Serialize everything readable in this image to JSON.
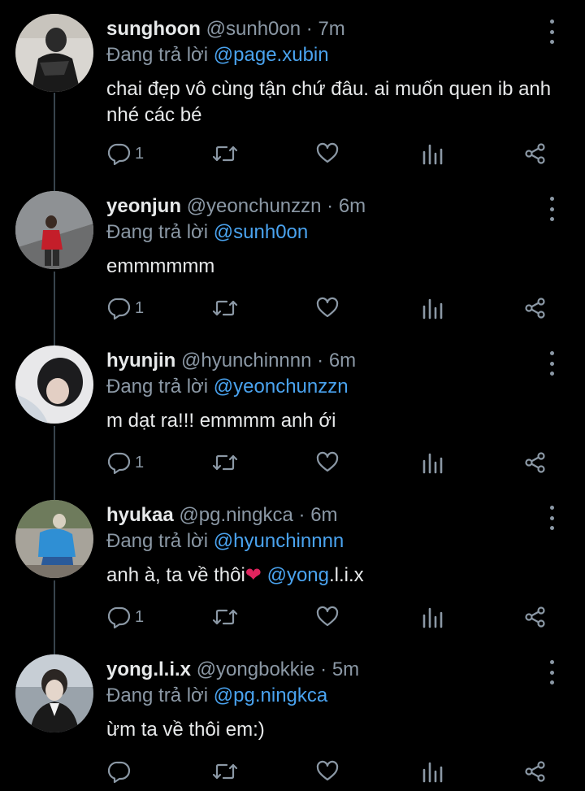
{
  "reply_prefix": "Đang trả lời",
  "tweets": [
    {
      "name": "sunghoon",
      "handle": "@sunh0on",
      "sep": "·",
      "time": "7m",
      "reply_to": "@page.xubin",
      "text": "chai đẹp vô cùng tận chứ đâu. ai muốn quen ib anh nhé các bé",
      "reply_count": "1"
    },
    {
      "name": "yeonjun",
      "handle": "@yeonchunzzn",
      "sep": "·",
      "time": "6m",
      "reply_to": "@sunh0on",
      "text": "emmmmmm",
      "reply_count": "1"
    },
    {
      "name": "hyunjin",
      "handle": "@hyunchinnnn",
      "sep": "·",
      "time": "6m",
      "reply_to": "@yeonchunzzn",
      "text": "m dạt ra!!! emmmm anh ới",
      "reply_count": "1"
    },
    {
      "name": "hyukaa",
      "handle": "@pg.ningkca",
      "sep": "·",
      "time": "6m",
      "reply_to": "@hyunchinnnn",
      "text_before": "anh à, ta về thôi",
      "heart": "❤",
      "mention": "@yong",
      "text_after": ".l.i.x",
      "reply_count": "1"
    },
    {
      "name": "yong.l.i.x",
      "handle": "@yongbokkie",
      "sep": "·",
      "time": "5m",
      "reply_to": "@pg.ningkca",
      "text": "ừm ta về thôi em:)",
      "reply_count": ""
    }
  ],
  "colors": {
    "background": "#000000",
    "text": "#e7e9ea",
    "muted": "#8b98a5",
    "link": "#4aa3ef",
    "thread_line": "#38444d"
  },
  "icons": [
    "reply-icon",
    "retweet-icon",
    "like-icon",
    "analytics-icon",
    "share-icon",
    "more-icon"
  ]
}
